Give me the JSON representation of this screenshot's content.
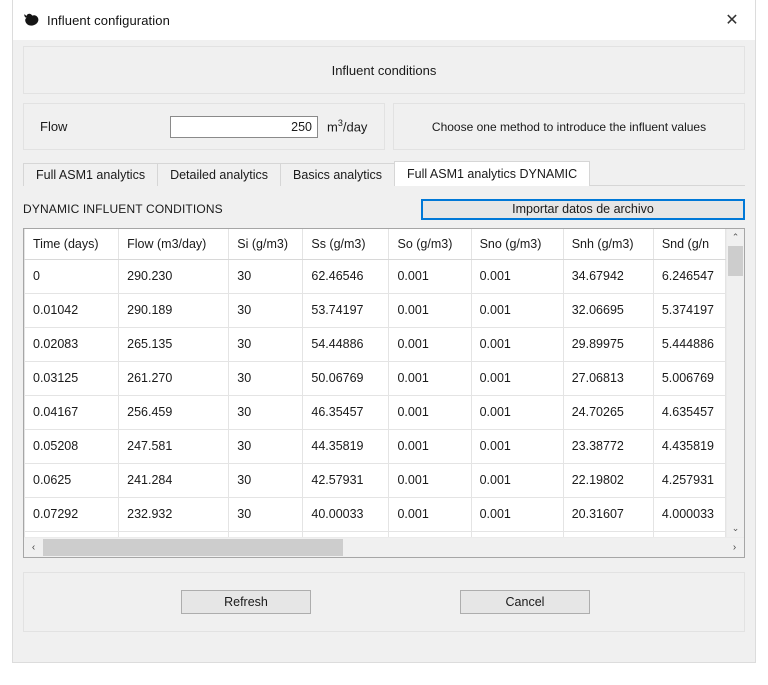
{
  "window": {
    "title": "Influent configuration",
    "icon": "app-blob-icon",
    "close_label": "✕"
  },
  "banner": {
    "text": "Influent conditions"
  },
  "flow": {
    "label": "Flow",
    "value": "250",
    "placeholder": "",
    "unit_prefix": "m",
    "unit_sup": "3",
    "unit_suffix": "/day"
  },
  "method": {
    "text": "Choose one method to introduce the influent values"
  },
  "tabs": [
    {
      "label": "Full ASM1 analytics",
      "active": false
    },
    {
      "label": "Detailed analytics",
      "active": false
    },
    {
      "label": "Basics analytics",
      "active": false
    },
    {
      "label": "Full ASM1 analytics DYNAMIC",
      "active": true
    }
  ],
  "dynamic": {
    "section_label": "DYNAMIC INFLUENT CONDITIONS",
    "import_button": "Importar datos de archivo",
    "import_button_focus_color": "#0078d7"
  },
  "table": {
    "columns": [
      "Time (days)",
      "Flow (m3/day)",
      "Si (g/m3)",
      "Ss (g/m3)",
      "So (g/m3)",
      "Sno (g/m3)",
      "Snh (g/m3)",
      "Snd (g/n"
    ],
    "rows": [
      [
        "0",
        "290.230",
        "30",
        "62.46546",
        "0.001",
        "0.001",
        "34.67942",
        "6.246547"
      ],
      [
        "0.01042",
        "290.189",
        "30",
        "53.74197",
        "0.001",
        "0.001",
        "32.06695",
        "5.374197"
      ],
      [
        "0.02083",
        "265.135",
        "30",
        "54.44886",
        "0.001",
        "0.001",
        "29.89975",
        "5.444886"
      ],
      [
        "0.03125",
        "261.270",
        "30",
        "50.06769",
        "0.001",
        "0.001",
        "27.06813",
        "5.006769"
      ],
      [
        "0.04167",
        "256.459",
        "30",
        "46.35457",
        "0.001",
        "0.001",
        "24.70265",
        "4.635457"
      ],
      [
        "0.05208",
        "247.581",
        "30",
        "44.35819",
        "0.001",
        "0.001",
        "23.38772",
        "4.435819"
      ],
      [
        "0.0625",
        "241.284",
        "30",
        "42.57931",
        "0.001",
        "0.001",
        "22.19802",
        "4.257931"
      ],
      [
        "0.07292",
        "232.932",
        "30",
        "40.00033",
        "0.001",
        "0.001",
        "20.31607",
        "4.000033"
      ],
      [
        "",
        "",
        "",
        "",
        "",
        "",
        "",
        ""
      ]
    ]
  },
  "scrollbars": {
    "vertical_up": "⌃",
    "vertical_down": "⌄",
    "horizontal_left": "‹",
    "horizontal_right": "›"
  },
  "footer": {
    "refresh_label": "Refresh",
    "cancel_label": "Cancel"
  }
}
